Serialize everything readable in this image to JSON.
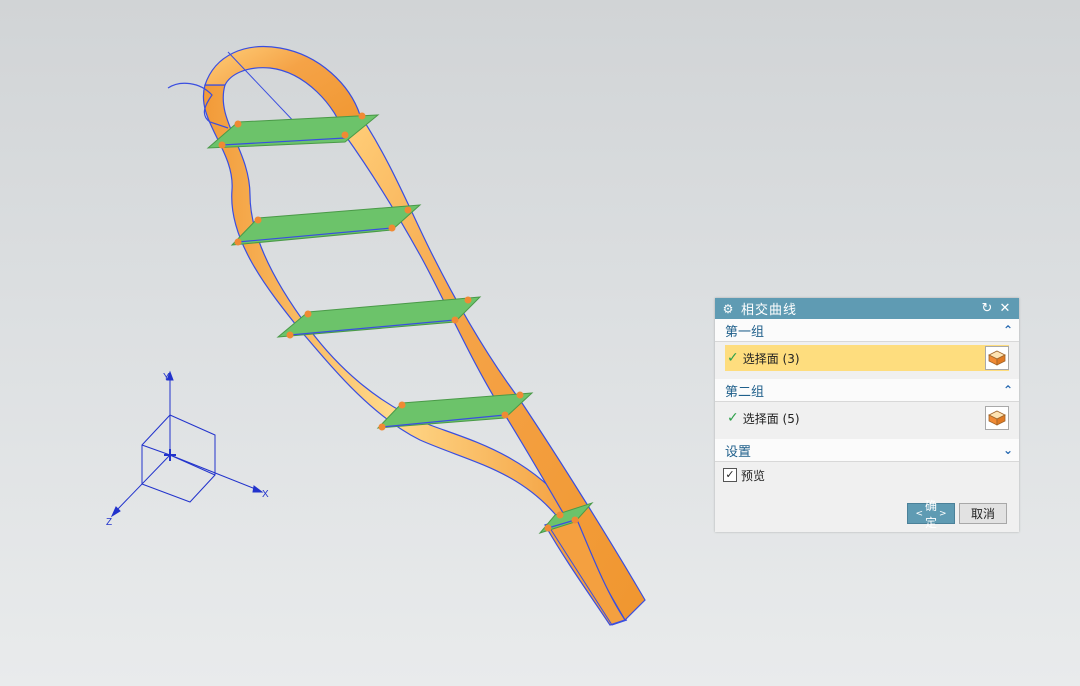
{
  "dialog": {
    "title": "相交曲线",
    "group1": {
      "title": "第一组",
      "select_label": "选择面 (3)"
    },
    "group2": {
      "title": "第二组",
      "select_label": "选择面 (5)"
    },
    "settings": {
      "title": "设置"
    },
    "preview": {
      "label": "预览",
      "checked": true
    },
    "ok_label": "确定",
    "cancel_label": "取消",
    "icons": {
      "gear": "gear-icon",
      "reset": "reset-icon",
      "close": "close-icon",
      "expand": "chevron-up-icon",
      "collapse": "chevron-down-icon",
      "face": "face-select-icon"
    }
  },
  "axis": {
    "x": "X",
    "y": "Y",
    "z": "Z"
  },
  "colors": {
    "band": "#f5a347",
    "band_highlight": "#ffd780",
    "edge": "#3a4ee0",
    "plane": "#6cc36a",
    "point": "#f08a34",
    "title_bar": "#5f9bb3",
    "active_row": "#fedd7e"
  }
}
